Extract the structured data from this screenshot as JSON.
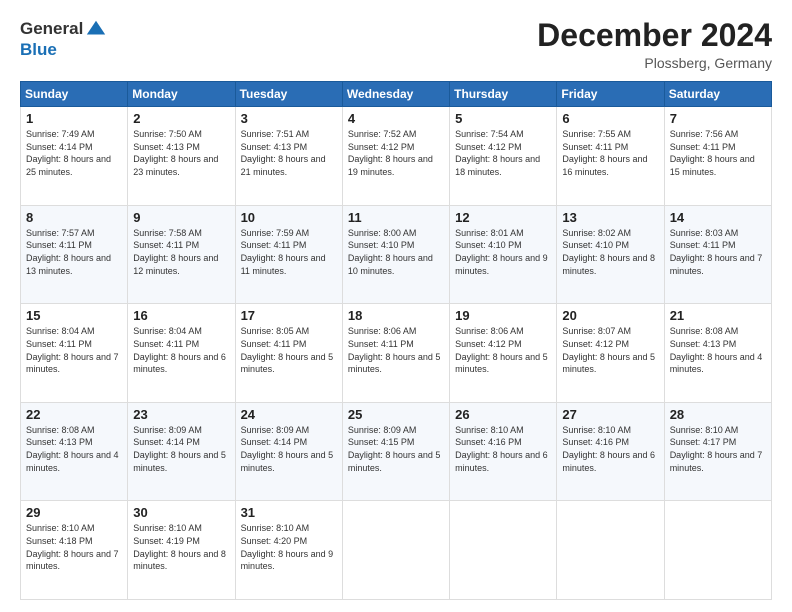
{
  "header": {
    "logo_general": "General",
    "logo_blue": "Blue",
    "title": "December 2024",
    "location": "Plossberg, Germany"
  },
  "days_of_week": [
    "Sunday",
    "Monday",
    "Tuesday",
    "Wednesday",
    "Thursday",
    "Friday",
    "Saturday"
  ],
  "weeks": [
    [
      {
        "day": "1",
        "sunrise": "7:49 AM",
        "sunset": "4:14 PM",
        "daylight": "8 hours and 25 minutes."
      },
      {
        "day": "2",
        "sunrise": "7:50 AM",
        "sunset": "4:13 PM",
        "daylight": "8 hours and 23 minutes."
      },
      {
        "day": "3",
        "sunrise": "7:51 AM",
        "sunset": "4:13 PM",
        "daylight": "8 hours and 21 minutes."
      },
      {
        "day": "4",
        "sunrise": "7:52 AM",
        "sunset": "4:12 PM",
        "daylight": "8 hours and 19 minutes."
      },
      {
        "day": "5",
        "sunrise": "7:54 AM",
        "sunset": "4:12 PM",
        "daylight": "8 hours and 18 minutes."
      },
      {
        "day": "6",
        "sunrise": "7:55 AM",
        "sunset": "4:11 PM",
        "daylight": "8 hours and 16 minutes."
      },
      {
        "day": "7",
        "sunrise": "7:56 AM",
        "sunset": "4:11 PM",
        "daylight": "8 hours and 15 minutes."
      }
    ],
    [
      {
        "day": "8",
        "sunrise": "7:57 AM",
        "sunset": "4:11 PM",
        "daylight": "8 hours and 13 minutes."
      },
      {
        "day": "9",
        "sunrise": "7:58 AM",
        "sunset": "4:11 PM",
        "daylight": "8 hours and 12 minutes."
      },
      {
        "day": "10",
        "sunrise": "7:59 AM",
        "sunset": "4:11 PM",
        "daylight": "8 hours and 11 minutes."
      },
      {
        "day": "11",
        "sunrise": "8:00 AM",
        "sunset": "4:10 PM",
        "daylight": "8 hours and 10 minutes."
      },
      {
        "day": "12",
        "sunrise": "8:01 AM",
        "sunset": "4:10 PM",
        "daylight": "8 hours and 9 minutes."
      },
      {
        "day": "13",
        "sunrise": "8:02 AM",
        "sunset": "4:10 PM",
        "daylight": "8 hours and 8 minutes."
      },
      {
        "day": "14",
        "sunrise": "8:03 AM",
        "sunset": "4:11 PM",
        "daylight": "8 hours and 7 minutes."
      }
    ],
    [
      {
        "day": "15",
        "sunrise": "8:04 AM",
        "sunset": "4:11 PM",
        "daylight": "8 hours and 7 minutes."
      },
      {
        "day": "16",
        "sunrise": "8:04 AM",
        "sunset": "4:11 PM",
        "daylight": "8 hours and 6 minutes."
      },
      {
        "day": "17",
        "sunrise": "8:05 AM",
        "sunset": "4:11 PM",
        "daylight": "8 hours and 5 minutes."
      },
      {
        "day": "18",
        "sunrise": "8:06 AM",
        "sunset": "4:11 PM",
        "daylight": "8 hours and 5 minutes."
      },
      {
        "day": "19",
        "sunrise": "8:06 AM",
        "sunset": "4:12 PM",
        "daylight": "8 hours and 5 minutes."
      },
      {
        "day": "20",
        "sunrise": "8:07 AM",
        "sunset": "4:12 PM",
        "daylight": "8 hours and 5 minutes."
      },
      {
        "day": "21",
        "sunrise": "8:08 AM",
        "sunset": "4:13 PM",
        "daylight": "8 hours and 4 minutes."
      }
    ],
    [
      {
        "day": "22",
        "sunrise": "8:08 AM",
        "sunset": "4:13 PM",
        "daylight": "8 hours and 4 minutes."
      },
      {
        "day": "23",
        "sunrise": "8:09 AM",
        "sunset": "4:14 PM",
        "daylight": "8 hours and 5 minutes."
      },
      {
        "day": "24",
        "sunrise": "8:09 AM",
        "sunset": "4:14 PM",
        "daylight": "8 hours and 5 minutes."
      },
      {
        "day": "25",
        "sunrise": "8:09 AM",
        "sunset": "4:15 PM",
        "daylight": "8 hours and 5 minutes."
      },
      {
        "day": "26",
        "sunrise": "8:10 AM",
        "sunset": "4:16 PM",
        "daylight": "8 hours and 6 minutes."
      },
      {
        "day": "27",
        "sunrise": "8:10 AM",
        "sunset": "4:16 PM",
        "daylight": "8 hours and 6 minutes."
      },
      {
        "day": "28",
        "sunrise": "8:10 AM",
        "sunset": "4:17 PM",
        "daylight": "8 hours and 7 minutes."
      }
    ],
    [
      {
        "day": "29",
        "sunrise": "8:10 AM",
        "sunset": "4:18 PM",
        "daylight": "8 hours and 7 minutes."
      },
      {
        "day": "30",
        "sunrise": "8:10 AM",
        "sunset": "4:19 PM",
        "daylight": "8 hours and 8 minutes."
      },
      {
        "day": "31",
        "sunrise": "8:10 AM",
        "sunset": "4:20 PM",
        "daylight": "8 hours and 9 minutes."
      },
      null,
      null,
      null,
      null
    ]
  ],
  "labels": {
    "sunrise": "Sunrise:",
    "sunset": "Sunset:",
    "daylight": "Daylight:"
  }
}
